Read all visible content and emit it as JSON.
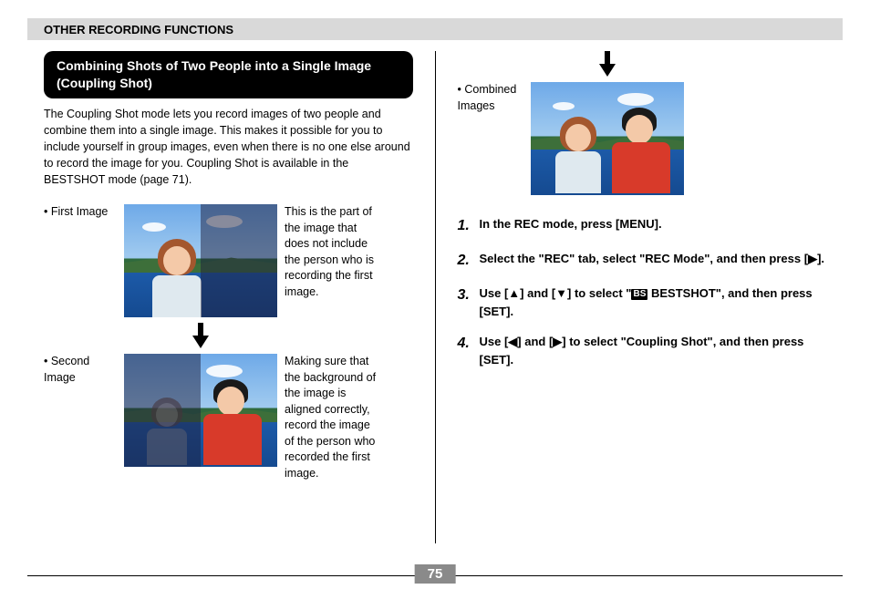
{
  "header": "OTHER RECORDING FUNCTIONS",
  "section_title": "Combining Shots of Two People into a Single Image (Coupling Shot)",
  "intro": "The Coupling Shot mode lets you record images of two people and combine them into a single image. This makes it possible for you to include yourself in group images, even when there is no one else around to record the image for you. Coupling Shot is available in the BESTSHOT mode (page 71).",
  "figures": {
    "first": {
      "label": "• First Image",
      "caption": "This is the part of the image that does not include the person who is recording the first image."
    },
    "second": {
      "label": "• Second Image",
      "caption": "Making sure that the background of the image is aligned correctly, record the image of the person who recorded the first image."
    },
    "combined": {
      "label": "• Combined Images"
    }
  },
  "steps": [
    {
      "num": "1.",
      "text": "In the REC mode, press [MENU]."
    },
    {
      "num": "2.",
      "text": "Select the \"REC\" tab, select \"REC Mode\", and then press [▶]."
    },
    {
      "num": "3.",
      "pre": "Use [▲] and [▼] to select \"",
      "bs": "BS",
      "post": " BESTSHOT\", and then press [SET]."
    },
    {
      "num": "4.",
      "text": "Use [◀] and [▶] to select \"Coupling Shot\", and then press [SET]."
    }
  ],
  "page_number": "75"
}
